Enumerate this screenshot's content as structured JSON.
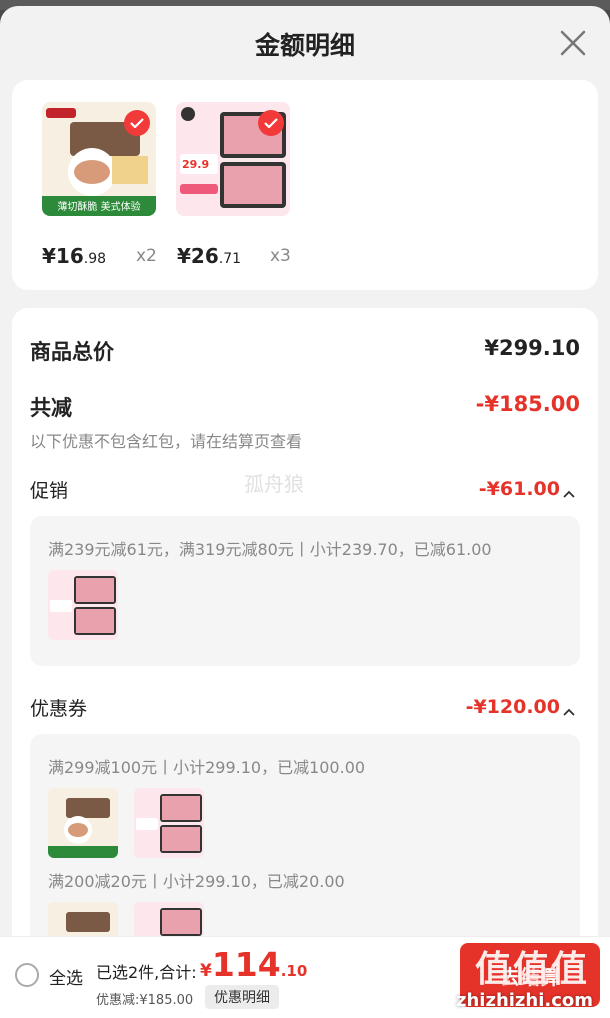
{
  "sheet": {
    "title": "金额明细"
  },
  "products": [
    {
      "price_int": "¥16",
      "price_dec": ".98",
      "qty": "x2",
      "banner_text": "薄切酥脆 美式体验"
    },
    {
      "price_int": "¥26",
      "price_dec": ".71",
      "qty": "x3",
      "promo_price": "29.9"
    }
  ],
  "detail": {
    "total_label": "商品总价",
    "total_value": "¥299.10",
    "reduce_label": "共减",
    "reduce_value": "-¥185.00",
    "note": "以下优惠不包含红包，请在结算页查看",
    "promo_label": "促销",
    "promo_value": "-¥61.00",
    "promo_rule": "满239元减61元，满319元减80元丨小计239.70，已减61.00",
    "coupon_label": "优惠券",
    "coupon_value": "-¥120.00",
    "coupon_rule1": "满299减100元丨小计299.10，已减100.00",
    "coupon_rule2": "满200减20元丨小计299.10，已减20.00"
  },
  "watermark": "孤舟狼",
  "bottom": {
    "select_all": "全选",
    "selected": "已选2件,合计:",
    "total_sym": "¥",
    "total_int": "114",
    "total_dec": ".10",
    "discount": "优惠减:¥185.00",
    "detail_btn": "优惠明细",
    "checkout": "去结算"
  },
  "overlay": {
    "logo": "值值值",
    "site": "zhizhizhi.com"
  },
  "colors": {
    "accent": "#e6332a",
    "background": "#f2f2f2"
  }
}
